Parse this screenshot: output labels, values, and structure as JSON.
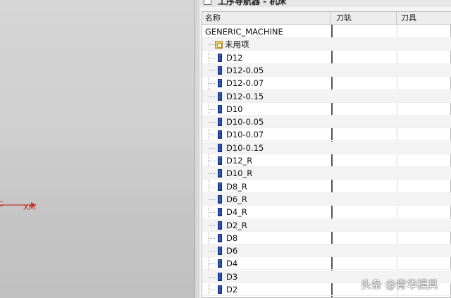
{
  "panel": {
    "title": "工序导航器 - 机床"
  },
  "columns": {
    "name": "名称",
    "tool_path": "刀轨",
    "tool": "刀具"
  },
  "root": "GENERIC_MACHINE",
  "unused": "未用项",
  "tools": [
    "D12",
    "D12-0.05",
    "D12-0.07",
    "D12-0.15",
    "D10",
    "D10-0.05",
    "D10-0.07",
    "D10-0.15",
    "D12_R",
    "D10_R",
    "D8_R",
    "D6_R",
    "D4_R",
    "D2_R",
    "D8",
    "D6",
    "D4",
    "D3",
    "D2"
  ],
  "viewport": {
    "axis_label_1": "C",
    "axis_label_2": "XM",
    "axis_color": "#c0392b"
  },
  "watermark": "头条 @青华模具"
}
